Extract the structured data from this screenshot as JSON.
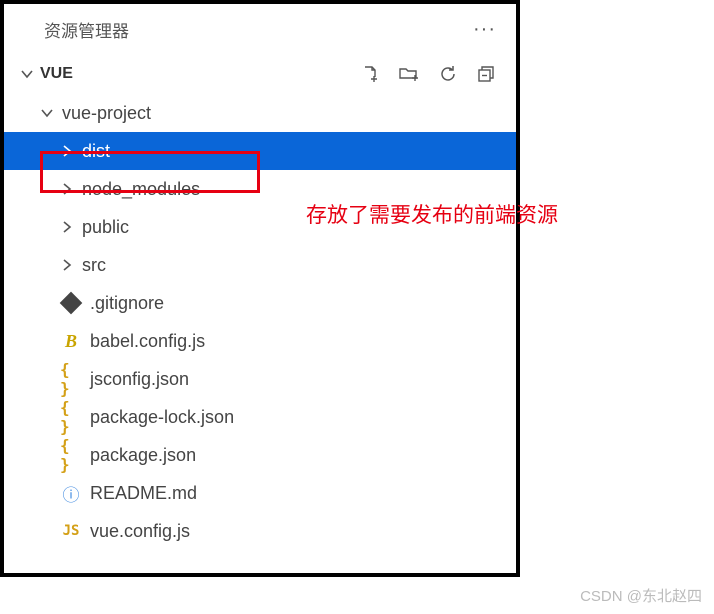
{
  "header": {
    "title": "资源管理器"
  },
  "section": {
    "title": "VUE"
  },
  "tree": {
    "project": "vue-project",
    "items": [
      {
        "label": "dist",
        "type": "folder",
        "selected": true
      },
      {
        "label": "node_modules",
        "type": "folder",
        "selected": false
      },
      {
        "label": "public",
        "type": "folder",
        "selected": false
      },
      {
        "label": "src",
        "type": "folder",
        "selected": false
      },
      {
        "label": ".gitignore",
        "type": "gitignore",
        "selected": false
      },
      {
        "label": "babel.config.js",
        "type": "babel",
        "selected": false
      },
      {
        "label": "jsconfig.json",
        "type": "json",
        "selected": false
      },
      {
        "label": "package-lock.json",
        "type": "json",
        "selected": false
      },
      {
        "label": "package.json",
        "type": "json",
        "selected": false
      },
      {
        "label": "README.md",
        "type": "info",
        "selected": false
      },
      {
        "label": "vue.config.js",
        "type": "js",
        "selected": false
      }
    ]
  },
  "annotation": "存放了需要发布的前端资源",
  "watermark": "CSDN @东北赵四"
}
